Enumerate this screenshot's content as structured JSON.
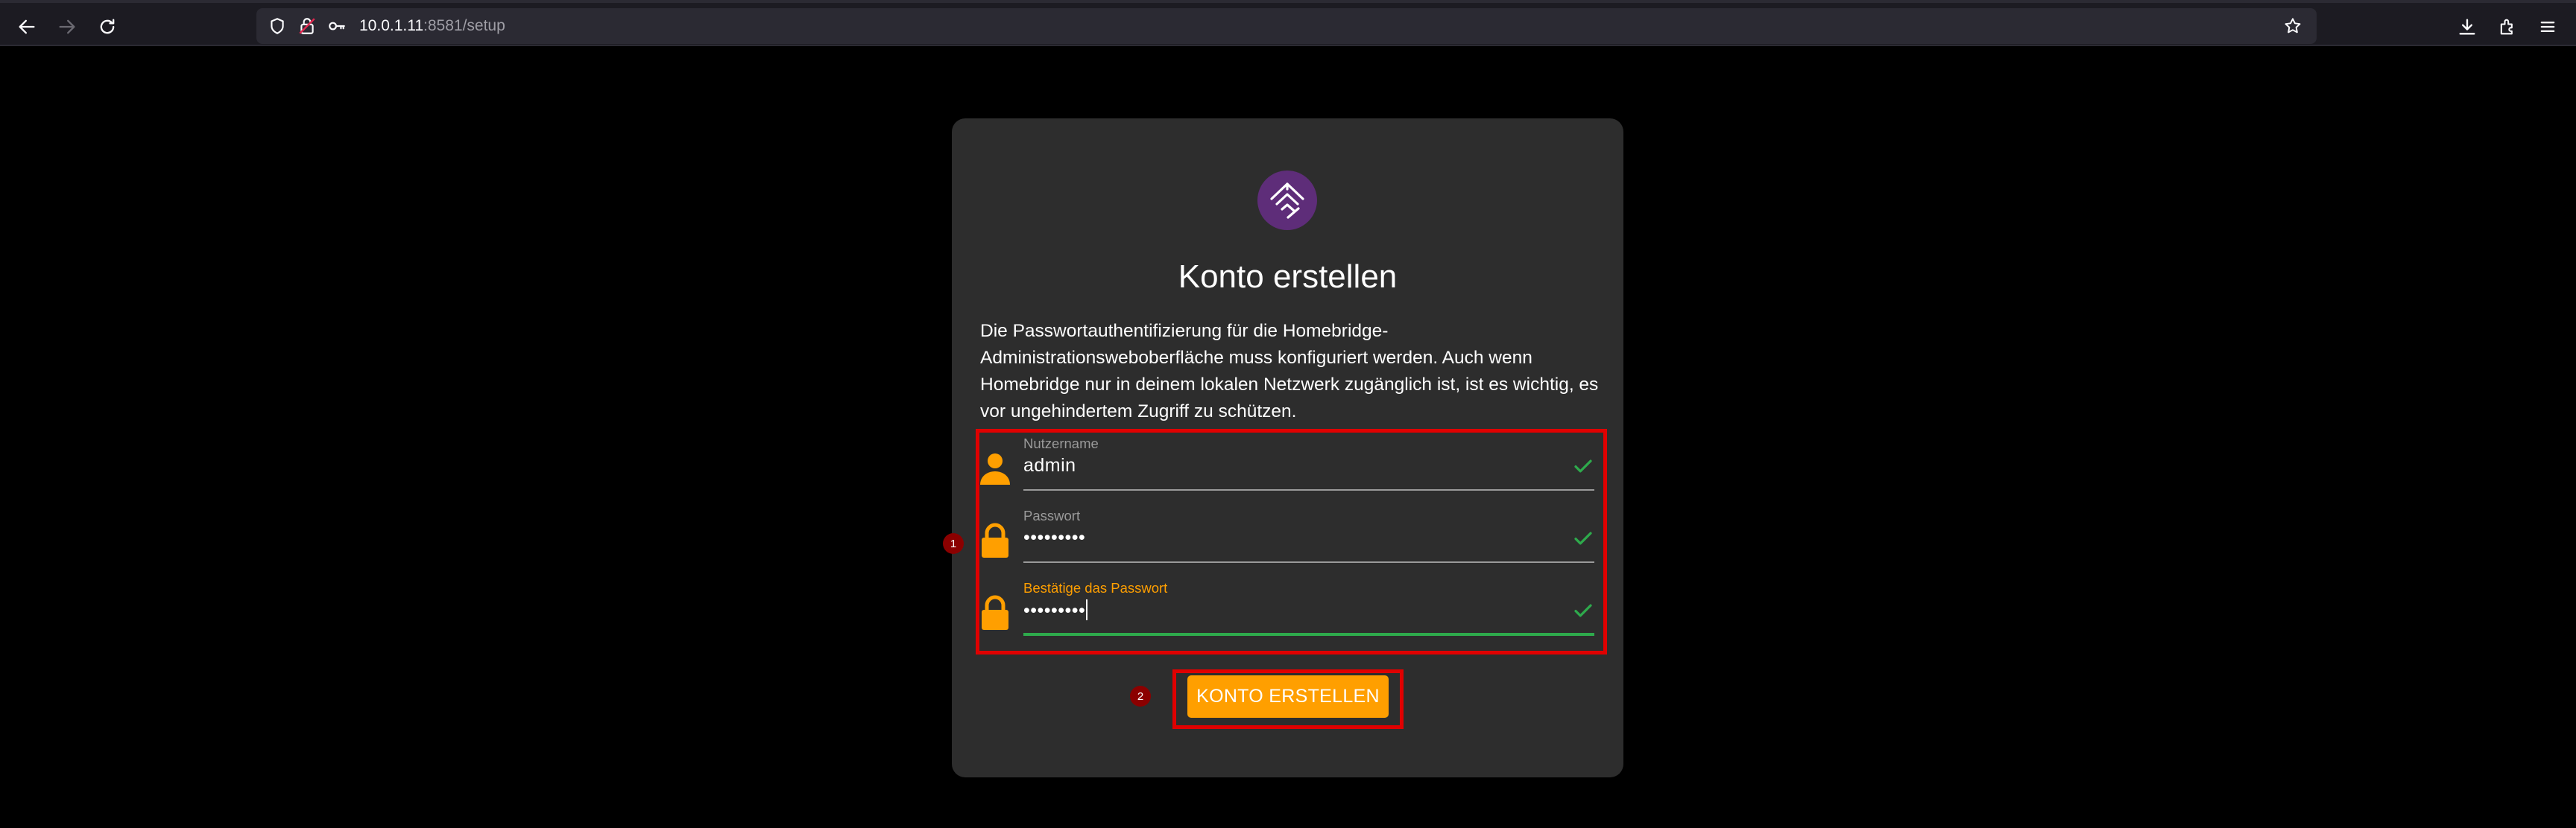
{
  "browser": {
    "url_host": "10.0.1.11",
    "url_rest": ":8581/setup"
  },
  "card": {
    "title": "Konto erstellen",
    "description": "Die Passwortauthentifizierung für die Homebridge-Administrationsweboberfläche muss konfiguriert werden. Auch wenn Homebridge nur in deinem lokalen Netzwerk zugänglich ist, ist es wichtig, es vor ungehindertem Zugriff zu schützen.",
    "fields": [
      {
        "label": "Nutzername",
        "value": "admin",
        "icon": "person-icon"
      },
      {
        "label": "Passwort",
        "value": "•••••••••",
        "icon": "lock-icon"
      },
      {
        "label": "Bestätige das Passwort",
        "value": "•••••••••",
        "icon": "lock-icon"
      }
    ],
    "submit_label": "KONTO ERSTELLEN"
  },
  "annotations": {
    "marker_1": "1",
    "marker_2": "2"
  },
  "colors": {
    "accent": "#ff9f00",
    "valid": "#2eaa4c",
    "highlight": "#e00000",
    "logo_bg": "#5e2d79"
  }
}
